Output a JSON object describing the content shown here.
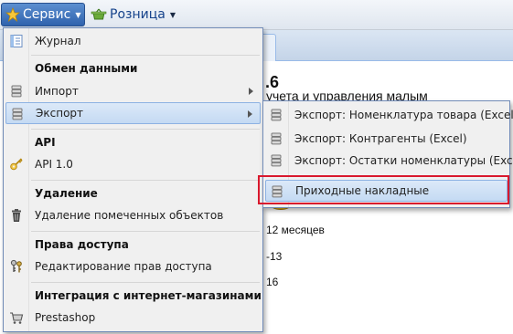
{
  "toolbar": {
    "service_label": "Сервис",
    "retail_label": "Розница"
  },
  "background": {
    "title_fragment": ".6",
    "subtitle_fragment": "учета и управления малым",
    "line1": "12 месяцев",
    "line2": "-13",
    "line3": "16"
  },
  "menu": {
    "journal": "Журнал",
    "exchange_header": "Обмен данными",
    "import": "Импорт",
    "export": "Экспорт",
    "api_header": "API",
    "api_version": "API 1.0",
    "delete_header": "Удаление",
    "delete_marked": "Удаление помеченных объектов",
    "rights_header": "Права доступа",
    "edit_rights": "Редактирование прав доступа",
    "integration_header": "Интеграция с интернет-магазинами",
    "prestashop": "Prestashop"
  },
  "submenu": {
    "export_products": "Экспорт: Номенклатура товара (Excel)",
    "export_contractors": "Экспорт: Контрагенты (Excel)",
    "export_stock": "Экспорт: Остатки номенклатуры (Excel)",
    "incoming_invoices": "Приходные накладные"
  },
  "colors": {
    "accent": "#2f62ad",
    "active_item": "#c4daf3",
    "highlight_frame": "#d9182d"
  }
}
